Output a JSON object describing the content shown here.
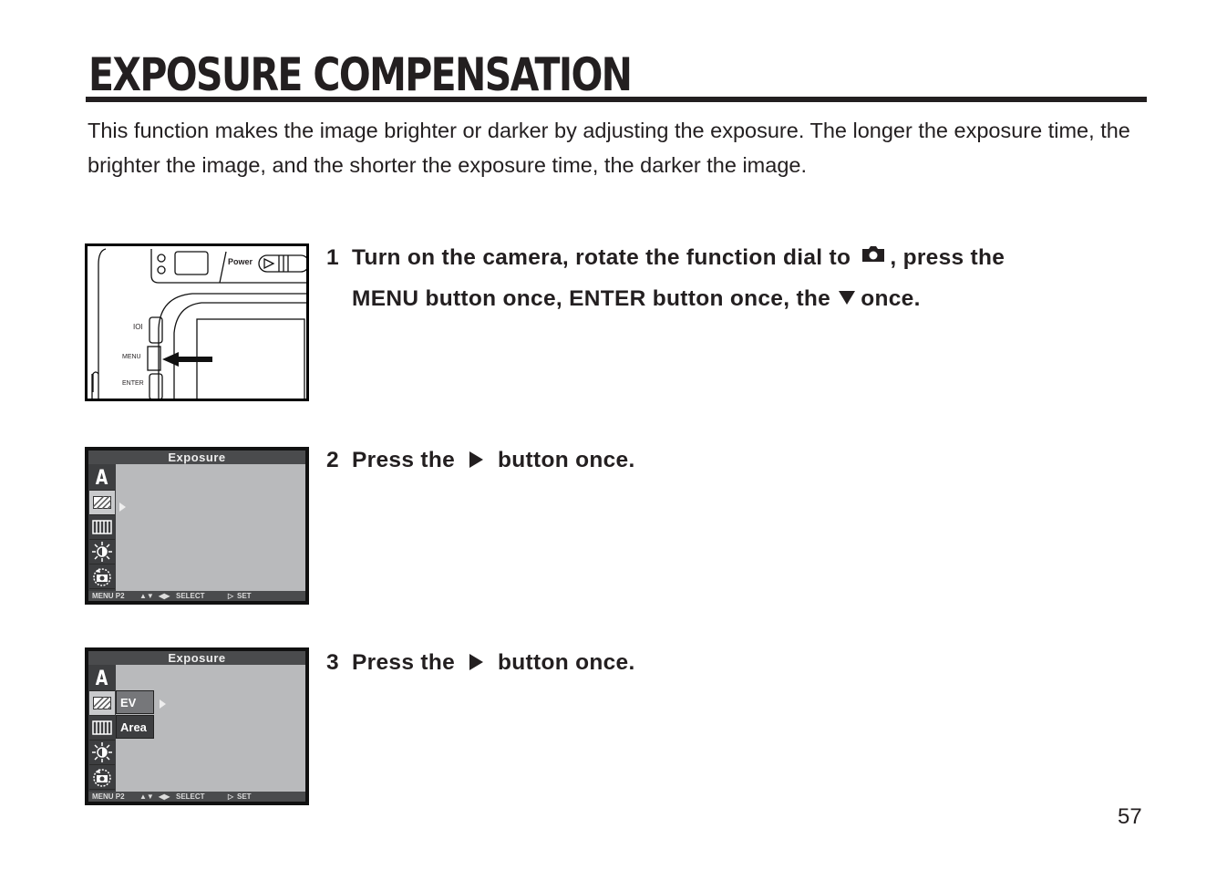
{
  "page": {
    "title": "EXPOSURE COMPENSATION",
    "intro": "This function makes the image brighter or darker by adjusting the exposure. The longer the exposure time, the brighter the image, and the shorter the exposure time, the darker the image.",
    "page_number": "57"
  },
  "steps": [
    {
      "number": "1",
      "line1_a": "Turn on the camera, rotate the function dial to",
      "line1_icon": "camera-icon",
      "line1_b": ", press the",
      "line2_a": "MENU button once, ENTER button once, the",
      "line2_icon": "down-triangle-icon",
      "line2_b": "once."
    },
    {
      "number": "2",
      "text_a": "Press the",
      "icon": "right-triangle-icon",
      "text_b": "button once."
    },
    {
      "number": "3",
      "text_a": "Press the",
      "icon": "right-triangle-icon",
      "text_b": "button once."
    }
  ],
  "figure_camera": {
    "power_label": "Power",
    "button_labels": [
      "IOI",
      "MENU",
      "ENTER"
    ]
  },
  "screen": {
    "header": "Exposure",
    "footer": {
      "menu": "MENU P2",
      "updown": "▲▼",
      "leftright": "◀▶",
      "select": "SELECT",
      "set_icon": "▷",
      "set": "SET"
    },
    "side_icons": [
      "auto-A-icon",
      "exposure-hatch-icon",
      "metering-area-icon",
      "brightness-icon",
      "reset-camera-icon"
    ],
    "auto_label": "A",
    "submenu": [
      "EV",
      "Area"
    ]
  }
}
